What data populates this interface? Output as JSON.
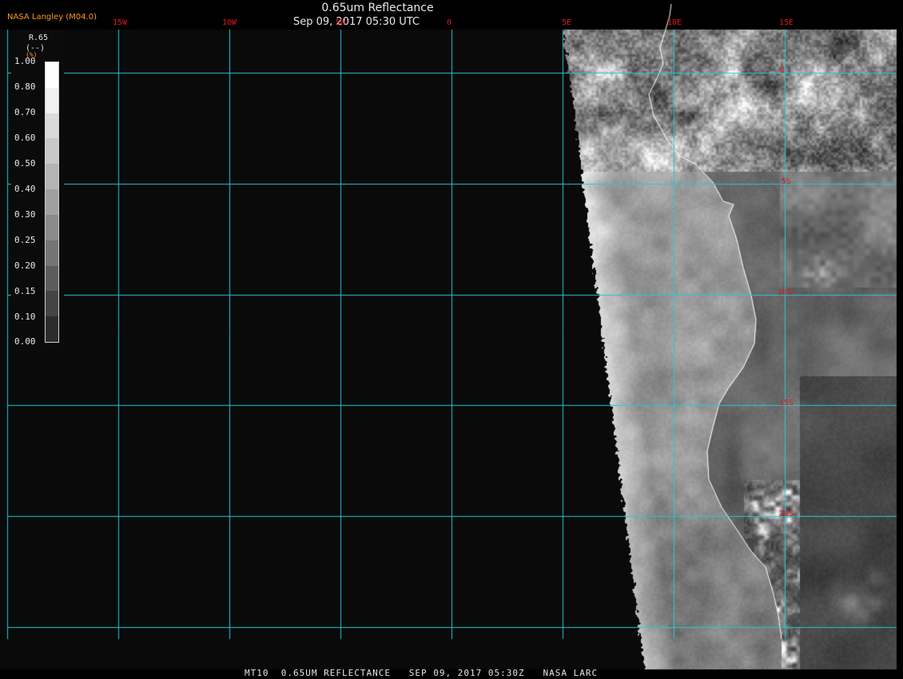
{
  "header": {
    "title": "0.65um Reflectance",
    "timestamp": "Sep 09, 2017 05:30 UTC",
    "source": "NASA Langley (M04.0)"
  },
  "footer": "MT10  0.65UM REFLECTANCE   SEP 09, 2017 05:30Z   NASA LARC",
  "legend": {
    "parameter": "R.65",
    "units": "(--)",
    "units_small": "(%)",
    "labels": [
      "1.00",
      "0.80",
      "0.70",
      "0.60",
      "0.50",
      "0.40",
      "0.30",
      "0.25",
      "0.20",
      "0.15",
      "0.10",
      "0.00"
    ],
    "shades": [
      "#ffffff",
      "#f0f0f0",
      "#dadada",
      "#c8c8c8",
      "#b4b4b4",
      "#a0a0a0",
      "#8a8a8a",
      "#747474",
      "#5c5c5c",
      "#444444",
      "#2c2c2c"
    ]
  },
  "grid": {
    "longitudes": [
      "15W",
      "10W",
      "5W",
      "0",
      "5E",
      "10E",
      "15E"
    ],
    "latitudes": [
      "0",
      "5S",
      "10S",
      "15S",
      "20S"
    ],
    "line_color": "#29c7d4",
    "label_color": "#e0181c"
  },
  "colors": {
    "background": "#0a0a0a",
    "coastline": "#ffffff"
  }
}
